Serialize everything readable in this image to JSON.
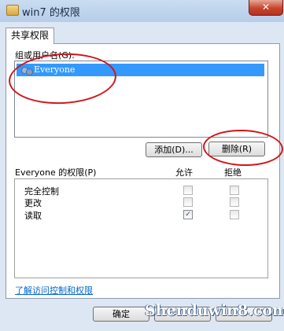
{
  "window": {
    "title": "win7 的权限",
    "close_icon": "✕"
  },
  "tab": {
    "label": "共享权限"
  },
  "group_section": {
    "label": "组或用户名(G):",
    "items": [
      {
        "name": "Everyone",
        "icon": "users-icon",
        "selected": true
      }
    ]
  },
  "buttons": {
    "add": "添加(D)...",
    "remove": "删除(R)",
    "ok": "确定"
  },
  "permissions": {
    "title": "Everyone 的权限(P)",
    "allow_header": "允许",
    "deny_header": "拒绝",
    "rows": [
      {
        "name": "完全控制",
        "allow": false,
        "deny": false
      },
      {
        "name": "更改",
        "allow": false,
        "deny": false
      },
      {
        "name": "读取",
        "allow": true,
        "deny": false
      }
    ]
  },
  "link": {
    "text": "了解访问控制和权限"
  },
  "watermark": {
    "text": "Shenduwin8.com"
  },
  "colors": {
    "selection": "#3399ff",
    "annotation": "#d0161b",
    "link": "#0066cc"
  }
}
